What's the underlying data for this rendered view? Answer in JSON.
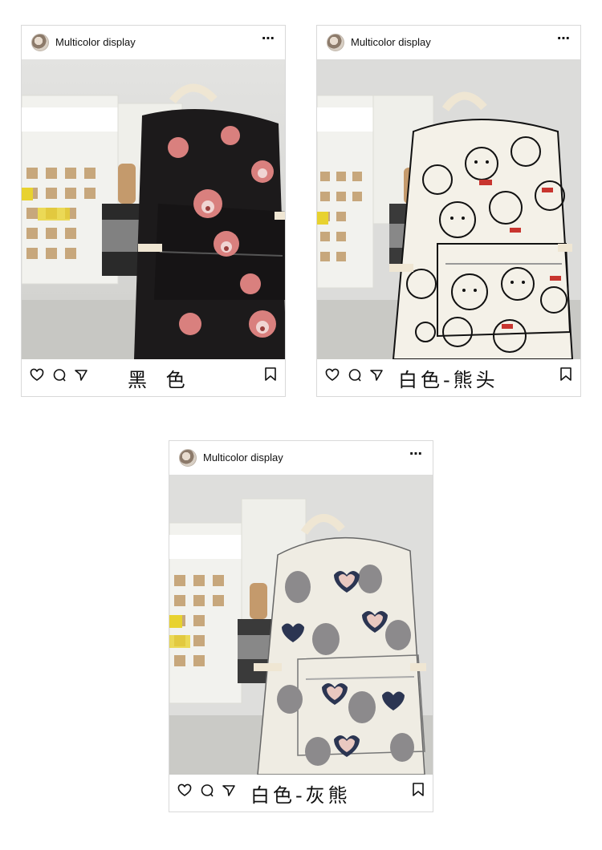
{
  "posts": [
    {
      "username": "Multicolor display",
      "more": "⋯",
      "caption": "黑 色",
      "variant": "black",
      "colors": {
        "bag": "#1c1a1b",
        "pattern": "#d9807e",
        "accent": "#f2ead8"
      },
      "icons": [
        "heart-icon",
        "comment-icon",
        "send-icon",
        "bookmark-icon"
      ]
    },
    {
      "username": "Multicolor display",
      "more": "⋯",
      "caption": "白色-熊头",
      "variant": "white-bear-head",
      "colors": {
        "bag": "#f4f1e8",
        "pattern": "#222222",
        "accent": "#c8352f"
      },
      "icons": [
        "heart-icon",
        "comment-icon",
        "send-icon",
        "bookmark-icon"
      ]
    },
    {
      "username": "Multicolor display",
      "more": "⋯",
      "caption": "白色-灰熊",
      "variant": "white-grey-bear",
      "colors": {
        "bag": "#efece3",
        "pattern": "#8c8a8c",
        "accent": "#2b3552"
      },
      "icons": [
        "heart-icon",
        "comment-icon",
        "send-icon",
        "bookmark-icon"
      ]
    }
  ]
}
